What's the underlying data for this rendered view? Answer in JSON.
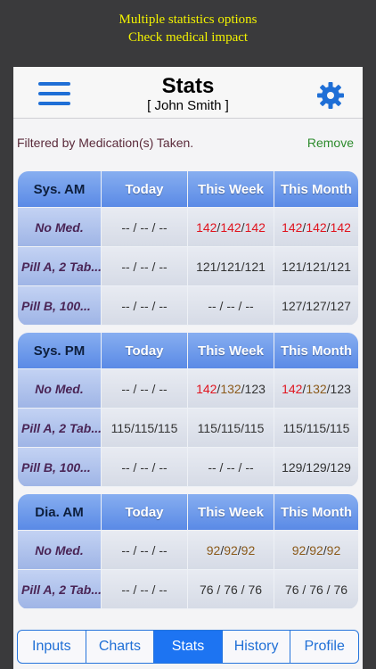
{
  "promo": {
    "line1": "Multiple statistics options",
    "line2": "Check medical impact"
  },
  "header": {
    "title": "Stats",
    "subtitle": "[ John Smith ]",
    "menu_icon": "hamburger-menu-icon",
    "settings_icon": "gear-icon"
  },
  "filter": {
    "text": "Filtered by Medication(s) Taken.",
    "remove_label": "Remove"
  },
  "columns": [
    "Today",
    "This Week",
    "This Month"
  ],
  "tables": [
    {
      "title": "Sys. AM",
      "rows": [
        {
          "label": "No Med.",
          "label_centered": true,
          "today": "-- / -- / --",
          "week": [
            [
              "142",
              "red"
            ],
            [
              "/",
              ""
            ],
            [
              "142",
              "red"
            ],
            [
              "/",
              ""
            ],
            [
              "142",
              "red"
            ]
          ],
          "month": [
            [
              "142",
              "red"
            ],
            [
              "/",
              ""
            ],
            [
              "142",
              "red"
            ],
            [
              "/",
              ""
            ],
            [
              "142",
              "red"
            ]
          ]
        },
        {
          "label": "Pill A, 2 Tab...",
          "label_centered": false,
          "today": "-- / -- / --",
          "week": [
            [
              "121/121/121",
              ""
            ]
          ],
          "month": [
            [
              "121/121/121",
              ""
            ]
          ]
        },
        {
          "label": "Pill B, 100...",
          "label_centered": false,
          "today": "-- / -- / --",
          "week": [
            [
              "-- / -- / --",
              ""
            ]
          ],
          "month": [
            [
              "127/127/127",
              ""
            ]
          ]
        }
      ]
    },
    {
      "title": "Sys. PM",
      "rows": [
        {
          "label": "No Med.",
          "label_centered": true,
          "today": "-- / -- / --",
          "week": [
            [
              "142",
              "red"
            ],
            [
              "/",
              ""
            ],
            [
              "132",
              "brown"
            ],
            [
              "/123",
              ""
            ]
          ],
          "month": [
            [
              "142",
              "red"
            ],
            [
              "/",
              ""
            ],
            [
              "132",
              "brown"
            ],
            [
              "/123",
              ""
            ]
          ]
        },
        {
          "label": "Pill A, 2 Tab...",
          "label_centered": false,
          "today": "115/115/115",
          "week": [
            [
              "115/115/115",
              ""
            ]
          ],
          "month": [
            [
              "115/115/115",
              ""
            ]
          ]
        },
        {
          "label": "Pill B, 100...",
          "label_centered": false,
          "today": "-- / -- / --",
          "week": [
            [
              "-- / -- / --",
              ""
            ]
          ],
          "month": [
            [
              "129/129/129",
              ""
            ]
          ]
        }
      ]
    },
    {
      "title": "Dia. AM",
      "rows": [
        {
          "label": "No Med.",
          "label_centered": true,
          "today": "-- / -- / --",
          "week": [
            [
              "92",
              "brown"
            ],
            [
              " / ",
              ""
            ],
            [
              "92",
              "brown"
            ],
            [
              " / ",
              ""
            ],
            [
              "92",
              "brown"
            ]
          ],
          "month": [
            [
              "92",
              "brown"
            ],
            [
              " / ",
              ""
            ],
            [
              "92",
              "brown"
            ],
            [
              " / ",
              ""
            ],
            [
              "92",
              "brown"
            ]
          ]
        },
        {
          "label": "Pill A, 2 Tab...",
          "label_centered": false,
          "today": "-- / -- / --",
          "week": [
            [
              "76 / 76 / 76",
              ""
            ]
          ],
          "month": [
            [
              "76 / 76 / 76",
              ""
            ]
          ]
        }
      ]
    }
  ],
  "tabs": [
    {
      "label": "Inputs",
      "active": false
    },
    {
      "label": "Charts",
      "active": false
    },
    {
      "label": "Stats",
      "active": true
    },
    {
      "label": "History",
      "active": false
    },
    {
      "label": "Profile",
      "active": false
    }
  ],
  "colors": {
    "accent": "#1d74f2",
    "header_gradient_top": "#87aef0",
    "high_value": "#e0141e",
    "mid_value": "#8b5a1a",
    "promo_text": "#f2f200"
  }
}
